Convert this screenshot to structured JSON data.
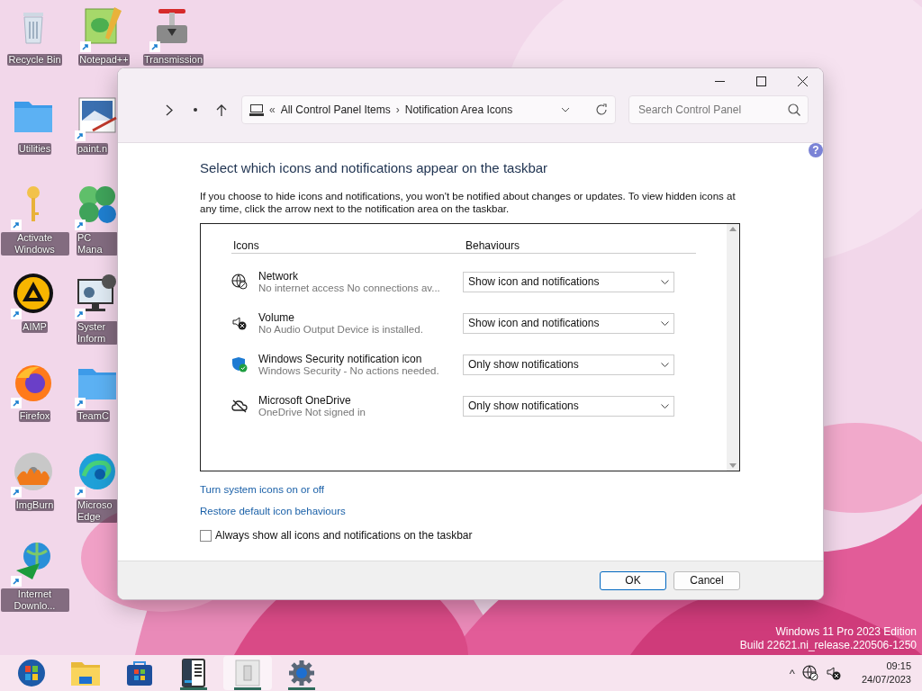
{
  "desktop_icons": [
    [
      {
        "label": "Recycle Bin",
        "kind": "bin",
        "shortcut": false
      },
      {
        "label": "Utilities",
        "kind": "folder",
        "shortcut": false
      },
      {
        "label": "Activate Windows",
        "kind": "key",
        "shortcut": true
      },
      {
        "label": "AIMP",
        "kind": "player",
        "shortcut": true
      },
      {
        "label": "Firefox",
        "kind": "browser",
        "shortcut": true
      },
      {
        "label": "ImgBurn",
        "kind": "disc",
        "shortcut": true
      },
      {
        "label": "Internet Downlo...",
        "kind": "globe",
        "shortcut": true
      }
    ],
    [
      {
        "label": "Notepad++",
        "kind": "notepad",
        "shortcut": true
      },
      {
        "label": "paint.n",
        "kind": "paint",
        "shortcut": true
      },
      {
        "label": "PC Mana",
        "kind": "leaves",
        "shortcut": true
      },
      {
        "label": "Syster Inform",
        "kind": "monitor",
        "shortcut": true
      },
      {
        "label": "TeamC",
        "kind": "folder",
        "shortcut": true
      },
      {
        "label": "Microso Edge",
        "kind": "wave",
        "shortcut": true
      }
    ],
    [
      {
        "label": "Transmission",
        "kind": "valve",
        "shortcut": true
      }
    ]
  ],
  "watermark": [
    "Windows 11 Pro 2023 Edition",
    "Build 22621.ni_release.220506-1250"
  ],
  "window": {
    "address": {
      "prefix": "«",
      "crumbs": [
        "All Control Panel Items",
        "Notification Area Icons"
      ],
      "separator": "›"
    },
    "search": {
      "placeholder": "Search Control Panel"
    },
    "help": "?",
    "heading": "Select which icons and notifications appear on the taskbar",
    "description": "If you choose to hide icons and notifications, you won't be notified about changes or updates. To view hidden icons at any time, click the arrow next to the notification area on the taskbar.",
    "table": {
      "columns": [
        "Icons",
        "Behaviours"
      ],
      "rows": [
        {
          "kind": "network",
          "name": "Network",
          "detail": "No internet access No connections av...",
          "behaviour": "Show icon and notifications"
        },
        {
          "kind": "volume",
          "name": "Volume",
          "detail": "No Audio Output Device is installed.",
          "behaviour": "Show icon and notifications"
        },
        {
          "kind": "shield",
          "name": "Windows Security notification icon",
          "detail": "Windows Security - No actions needed.",
          "behaviour": "Only show notifications"
        },
        {
          "kind": "cloud",
          "name": "Microsoft OneDrive",
          "detail": "OneDrive Not signed in",
          "behaviour": "Only show notifications"
        }
      ]
    },
    "links": [
      "Turn system icons on or off",
      "Restore default icon behaviours"
    ],
    "always_show": {
      "label": "Always show all icons and notifications on the taskbar",
      "checked": false
    },
    "buttons": [
      {
        "label": "OK",
        "selected": true
      },
      {
        "label": "Cancel",
        "selected": false
      }
    ]
  },
  "taskbar": {
    "apps": [
      {
        "kind": "start",
        "running": false,
        "selected": false
      },
      {
        "kind": "explorer",
        "running": false,
        "selected": false
      },
      {
        "kind": "store",
        "running": false,
        "selected": false
      },
      {
        "kind": "book",
        "running": true,
        "selected": false
      },
      {
        "kind": "panel",
        "running": true,
        "selected": true
      },
      {
        "kind": "gear",
        "running": true,
        "selected": false
      }
    ],
    "tray_chevron": "^",
    "time": "09:15",
    "date": "24/07/2023"
  }
}
